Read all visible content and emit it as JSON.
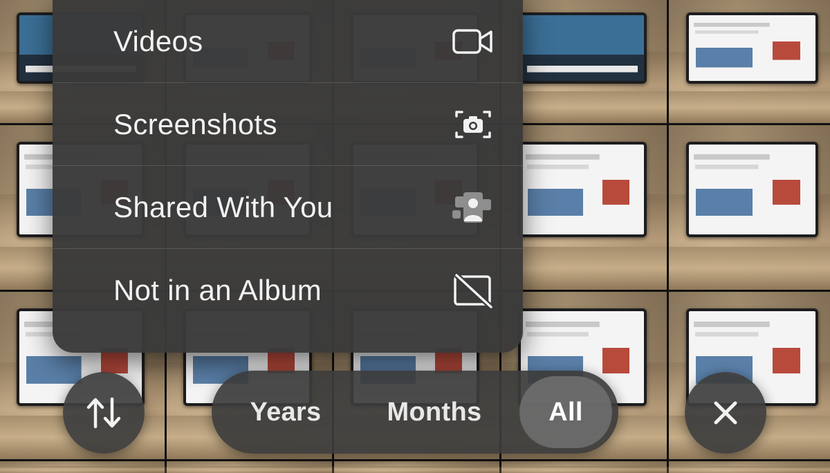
{
  "menu": {
    "items": [
      {
        "label": "Videos",
        "icon": "video-camera-icon"
      },
      {
        "label": "Screenshots",
        "icon": "screenshot-camera-icon"
      },
      {
        "label": "Shared With You",
        "icon": "shared-with-you-icon"
      },
      {
        "label": "Not in an Album",
        "icon": "album-slash-icon"
      }
    ]
  },
  "toolbar": {
    "sort_icon": "sort-arrows-icon",
    "close_icon": "close-x-icon",
    "segments": [
      {
        "label": "Years",
        "active": false
      },
      {
        "label": "Months",
        "active": false
      },
      {
        "label": "All",
        "active": true
      }
    ]
  },
  "colors": {
    "menu_background": "#3a3a3a",
    "text": "#f2f2f2",
    "active_segment": "#6e6e6e"
  }
}
